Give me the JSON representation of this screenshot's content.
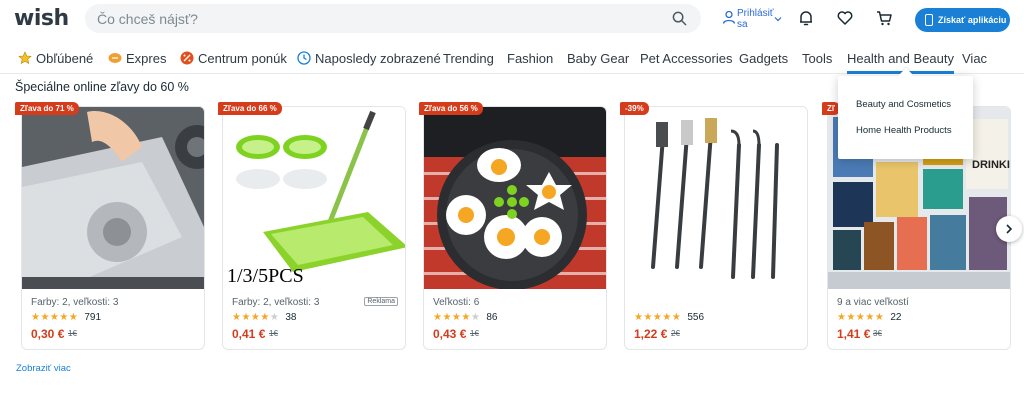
{
  "header": {
    "logo": "wish",
    "search_placeholder": "Čo chceš nájsť?",
    "login_label": "Prihlásiť sa",
    "app_button": "Získať aplikáciu"
  },
  "nav": {
    "items": [
      {
        "label": "Obľúbené",
        "icon": "star-icon"
      },
      {
        "label": "Expres",
        "icon": "express-icon"
      },
      {
        "label": "Centrum ponúk",
        "icon": "deals-icon"
      },
      {
        "label": "Naposledy zobrazené",
        "icon": "clock-icon"
      },
      {
        "label": "Trending"
      },
      {
        "label": "Fashion"
      },
      {
        "label": "Baby Gear"
      },
      {
        "label": "Pet Accessories"
      },
      {
        "label": "Gadgets"
      },
      {
        "label": "Tools"
      },
      {
        "label": "Health and Beauty",
        "active": true
      },
      {
        "label": "Viac"
      }
    ]
  },
  "dropdown": {
    "items": [
      "Beauty and Cosmetics",
      "Home Health Products"
    ]
  },
  "section": {
    "title": "Špeciálne online zľavy do 60 %",
    "more_link": "Zobraziť viac"
  },
  "products": [
    {
      "badge": "Zľava do 71 %",
      "variant": "Farby: 2, veľkosti: 3",
      "stars": 4.5,
      "reviews": "791",
      "price": "0,30 €",
      "old_price": "1€",
      "ad": ""
    },
    {
      "badge": "Zľava do 66 %",
      "variant": "Farby: 2, veľkosti: 3",
      "stars": 4,
      "reviews": "38",
      "price": "0,41 €",
      "old_price": "1€",
      "ad": "Reklama",
      "image_text": "1/3/5PCS"
    },
    {
      "badge": "Zľava do 56 %",
      "variant": "Veľkosti: 6",
      "stars": 4,
      "reviews": "86",
      "price": "0,43 €",
      "old_price": "1€",
      "ad": ""
    },
    {
      "badge": "-39%",
      "variant": "",
      "stars": 4.5,
      "reviews": "556",
      "price": "1,22 €",
      "old_price": "2€",
      "ad": ""
    },
    {
      "badge": "Zľ",
      "variant": "9 a viac veľkostí",
      "stars": 4.5,
      "reviews": "22",
      "price": "1,41 €",
      "old_price": "3€",
      "ad": "",
      "image_text": "DRINKING"
    }
  ],
  "colors": {
    "accent": "#1a80d6",
    "sale": "#d43c1b",
    "star": "#f5a623"
  }
}
